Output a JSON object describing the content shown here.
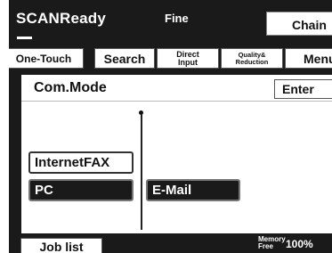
{
  "header": {
    "title": "SCANReady",
    "mode": "Fine",
    "chain_button": "Chain"
  },
  "tabs": [
    {
      "label": "One-Touch"
    },
    {
      "label": "Search"
    },
    {
      "label_line1": "Direct",
      "label_line2": "Input"
    },
    {
      "label_line1": "Quality&",
      "label_line2": "Reduction"
    },
    {
      "label": "Menu"
    }
  ],
  "panel": {
    "title": "Com.Mode",
    "enter_button": "Enter",
    "options": {
      "internetfax": "InternetFAX",
      "pc": "PC",
      "email": "E-Mail"
    }
  },
  "footer": {
    "job_list": "Job list",
    "memory_line1": "Memory",
    "memory_line2": "Free",
    "memory_value": "100%"
  }
}
